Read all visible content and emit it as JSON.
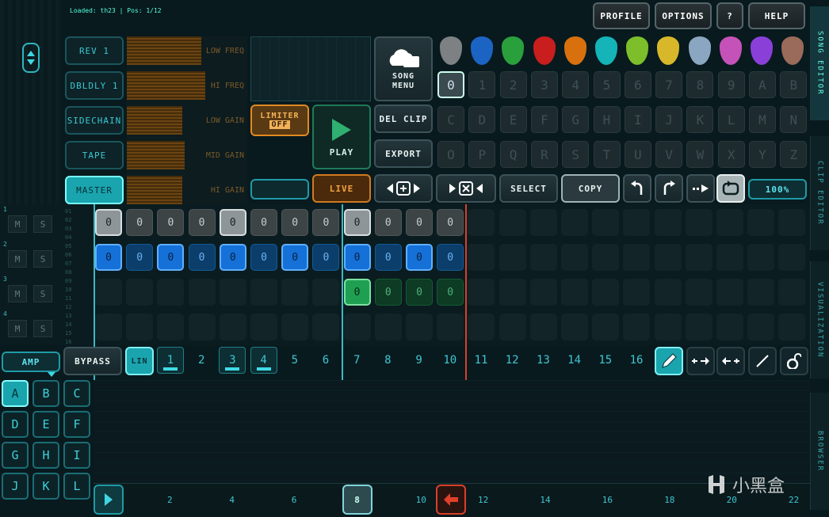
{
  "status": {
    "text": "Loaded: th23 | Pos: 1/12"
  },
  "top_menu": {
    "profile": "PROFILE",
    "options": "OPTIONS",
    "help_q": "?",
    "help": "HELP"
  },
  "side_tabs": [
    "SONG EDITOR",
    "CLIP EDITOR",
    "VISUALIZATION",
    "BROWSER"
  ],
  "fx": {
    "labels": [
      "REV 1",
      "DBLDLY 1",
      "SIDECHAIN",
      "TAPE",
      "MASTER"
    ],
    "bars": [
      "LOW FREQ",
      "HI FREQ",
      "LOW GAIN",
      "MID GAIN",
      "HI GAIN"
    ],
    "bar_levels": [
      0.62,
      0.65,
      0.46,
      0.48,
      0.46
    ],
    "limiter": "LIMITER",
    "limiter_state": "OFF",
    "play": "PLAY",
    "live": "LIVE"
  },
  "song": {
    "menu_line1": "SONG",
    "menu_line2": "MENU",
    "del_clip": "DEL CLIP",
    "export": "EXPORT",
    "select": "SELECT",
    "copy": "COPY",
    "zoom": "100%"
  },
  "palette": {
    "colors": [
      "#7d8183",
      "#1c64c4",
      "#2aa03c",
      "#c81e1e",
      "#d9700e",
      "#14b4b8",
      "#7cbf2a",
      "#d8b82a",
      "#8aa6c0",
      "#c552b8",
      "#8a40d8",
      "#9a6a5a"
    ],
    "keys": [
      "0",
      "1",
      "2",
      "3",
      "4",
      "5",
      "6",
      "7",
      "8",
      "9",
      "A",
      "B",
      "C",
      "D",
      "E",
      "F",
      "G",
      "H",
      "I",
      "J",
      "K",
      "L",
      "M",
      "N",
      "O",
      "P",
      "Q",
      "R",
      "S",
      "T",
      "U",
      "V",
      "W",
      "X",
      "Y",
      "Z"
    ]
  },
  "tracks": {
    "numbers": [
      "1",
      "2",
      "3",
      "4"
    ],
    "mute": "M",
    "solo": "S",
    "row_labels": [
      "01",
      "02",
      "03",
      "04",
      "05",
      "06",
      "07",
      "08",
      "09",
      "10",
      "11",
      "12",
      "13",
      "14",
      "15",
      "16"
    ],
    "cell_text": "0",
    "track1": [
      "hi",
      "lo",
      "lo",
      "lo",
      "hi",
      "lo",
      "lo",
      "lo",
      "hi",
      "lo",
      "lo",
      "lo"
    ],
    "track2": [
      "hi",
      "lo",
      "hi",
      "lo",
      "hi",
      "lo",
      "hi",
      "lo",
      "hi",
      "lo",
      "hi",
      "lo"
    ],
    "track3": [
      "",
      "",
      "",
      "",
      "",
      "",
      "",
      "",
      "hi",
      "lo",
      "lo",
      "lo"
    ]
  },
  "clip": {
    "mode": "AMP",
    "bypass": "BYPASS",
    "lin": "LIN",
    "steps": [
      "1",
      "2",
      "3",
      "4",
      "5",
      "6",
      "7",
      "8",
      "9",
      "10",
      "11",
      "12",
      "13",
      "14",
      "15",
      "16"
    ],
    "active_steps": [
      1,
      3,
      4
    ],
    "letters": [
      "A",
      "B",
      "C",
      "D",
      "E",
      "F",
      "G",
      "H",
      "I",
      "J",
      "K",
      "L"
    ]
  },
  "timeline": {
    "marks": [
      "2",
      "4",
      "6",
      "8",
      "10",
      "12",
      "14",
      "16",
      "18",
      "20",
      "22"
    ]
  },
  "watermark": "小黑盒"
}
